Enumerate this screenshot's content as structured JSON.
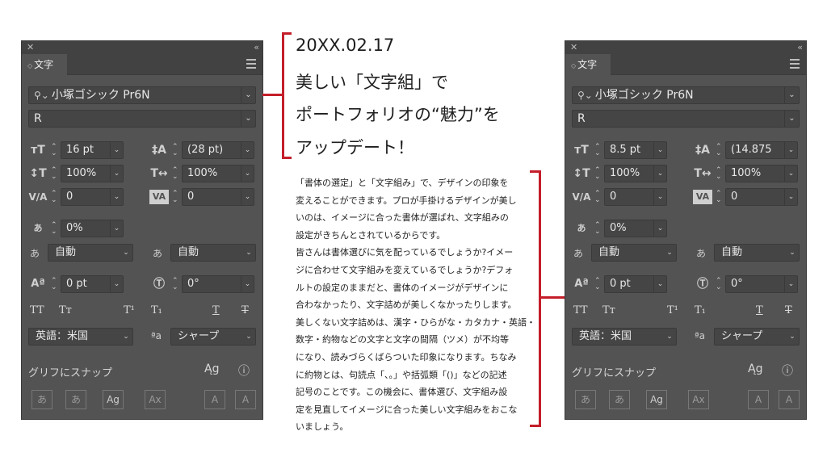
{
  "panel_left": {
    "tab_label": "文字",
    "font_family": "小塚ゴシック Pr6N",
    "font_style": "R",
    "font_size": "16 pt",
    "leading": "(28 pt)",
    "vertical_scale": "100%",
    "horizontal_scale": "100%",
    "kerning": "0",
    "tracking": "0",
    "tsume": "0%",
    "mojikumi_before": "自動",
    "mojikumi_after": "自動",
    "baseline_shift": "0 pt",
    "rotation": "0°",
    "language": "英語：米国",
    "antialias": "シャープ",
    "snap_label": "グリフにスナップ"
  },
  "panel_right": {
    "tab_label": "文字",
    "font_family": "小塚ゴシック Pr6N",
    "font_style": "R",
    "font_size": "8.5 pt",
    "leading": "(14.875",
    "vertical_scale": "100%",
    "horizontal_scale": "100%",
    "kerning": "0",
    "tracking": "0",
    "tsume": "0%",
    "mojikumi_before": "自動",
    "mojikumi_after": "自動",
    "baseline_shift": "0 pt",
    "rotation": "0°",
    "language": "英語：米国",
    "antialias": "シャープ",
    "snap_label": "グリフにスナップ"
  },
  "heading": {
    "line1": "20XX.02.17",
    "line2": "美しい「文字組」で",
    "line3": "ポートフォリオの“魅力”を",
    "line4": "アップデート！"
  },
  "body_lines": [
    "「書体の選定」と「文字組み」で、デザインの印象を",
    "変えることができます。プロが手掛けるデザインが美し",
    "いのは、イメージに合った書体が選ばれ、文字組みの",
    "設定がきちんとされているからです。",
    "皆さんは書体選びに気を配っているでしょうか?イメー",
    "ジに合わせて文字組みを変えているでしょうか?デフォ",
    "ルトの設定のままだと、書体のイメージがデザインに",
    "合わなかったり、文字詰めが美しくなかったりします。",
    "美しくない文字詰めは、漢字・ひらがな・カタカナ・英語・",
    "数字・約物などの文字と文字の間隔（ツメ）が不均等",
    "になり、読みづらくばらついた印象になります。ちなみ",
    "に約物とは、句読点「、。」や括弧類「()」などの記述",
    "記号のことです。この機会に、書体選び、文字組み設",
    "定を見直してイメージに合った美しい文字組みをおこな",
    "いましょう。"
  ],
  "colors": {
    "panel_bg": "#535353",
    "field_bg": "#454545",
    "accent_red": "#c41e2a"
  }
}
